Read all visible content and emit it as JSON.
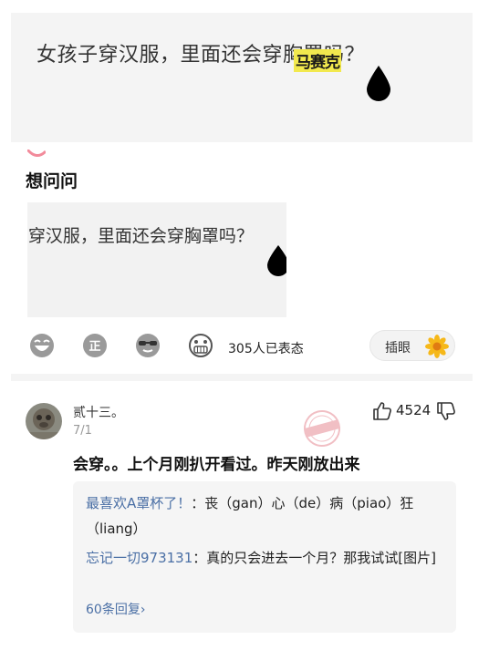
{
  "post": {
    "title": "女孩子穿汉服，里面还会穿胸罩吗？",
    "watermark_label": "马赛克",
    "pink_mark_color": "#f28b9b",
    "section_title": "想问问",
    "thumbnail_text": "-穿汉服，里面还会穿胸罩吗？"
  },
  "reactions": {
    "icons": [
      "laughing-emoji-icon",
      "zheng-emoji-icon",
      "sunglasses-emoji-icon",
      "grinning-emoji-icon"
    ],
    "count_text": "305人已表态",
    "chayan_label": "插眼"
  },
  "comment": {
    "user_name": "贰十三。",
    "date": "7/1",
    "like_count": "4524",
    "text": "会穿。。上个月刚扒开看过。昨天刚放出来",
    "replies": [
      {
        "author": "最喜欢A罩杯了！",
        "sep": "：",
        "text": "丧（gan）心（de）病（piao）狂（liang）"
      },
      {
        "author": "忘记一切973131",
        "sep": "：",
        "text": "真的只会进去一个月？那我试试[图片]"
      }
    ],
    "more_replies": "60条回复›"
  },
  "colors": {
    "link": "#4a6fa5",
    "card_bg": "#f4f4f4",
    "stamp": "#d9495a"
  }
}
